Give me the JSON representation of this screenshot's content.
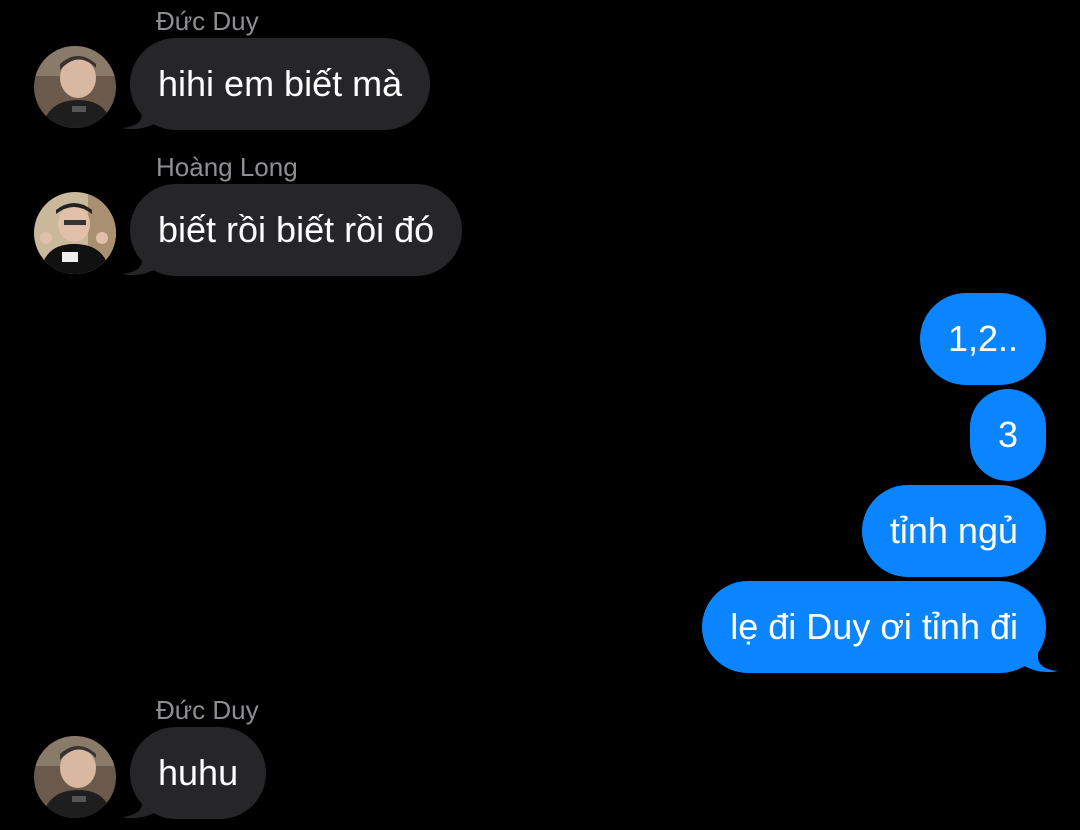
{
  "colors": {
    "background": "#000000",
    "incoming_bubble": "#262629",
    "outgoing_bubble": "#0a84ff",
    "sender_name": "#8e8e93",
    "text": "#ffffff"
  },
  "messages": [
    {
      "sender": "Đức Duy",
      "text": "hihi em biết mà",
      "direction": "incoming",
      "avatar": "duc-duy-avatar"
    },
    {
      "sender": "Hoàng Long",
      "text": "biết rồi biết rồi đó",
      "direction": "incoming",
      "avatar": "hoang-long-avatar"
    },
    {
      "text": "1,2..",
      "direction": "outgoing"
    },
    {
      "text": "3",
      "direction": "outgoing"
    },
    {
      "text": "tỉnh ngủ",
      "direction": "outgoing"
    },
    {
      "text": "lẹ đi Duy ơi tỉnh đi",
      "direction": "outgoing"
    },
    {
      "sender": "Đức Duy",
      "text": "huhu",
      "direction": "incoming",
      "avatar": "duc-duy-avatar"
    }
  ]
}
